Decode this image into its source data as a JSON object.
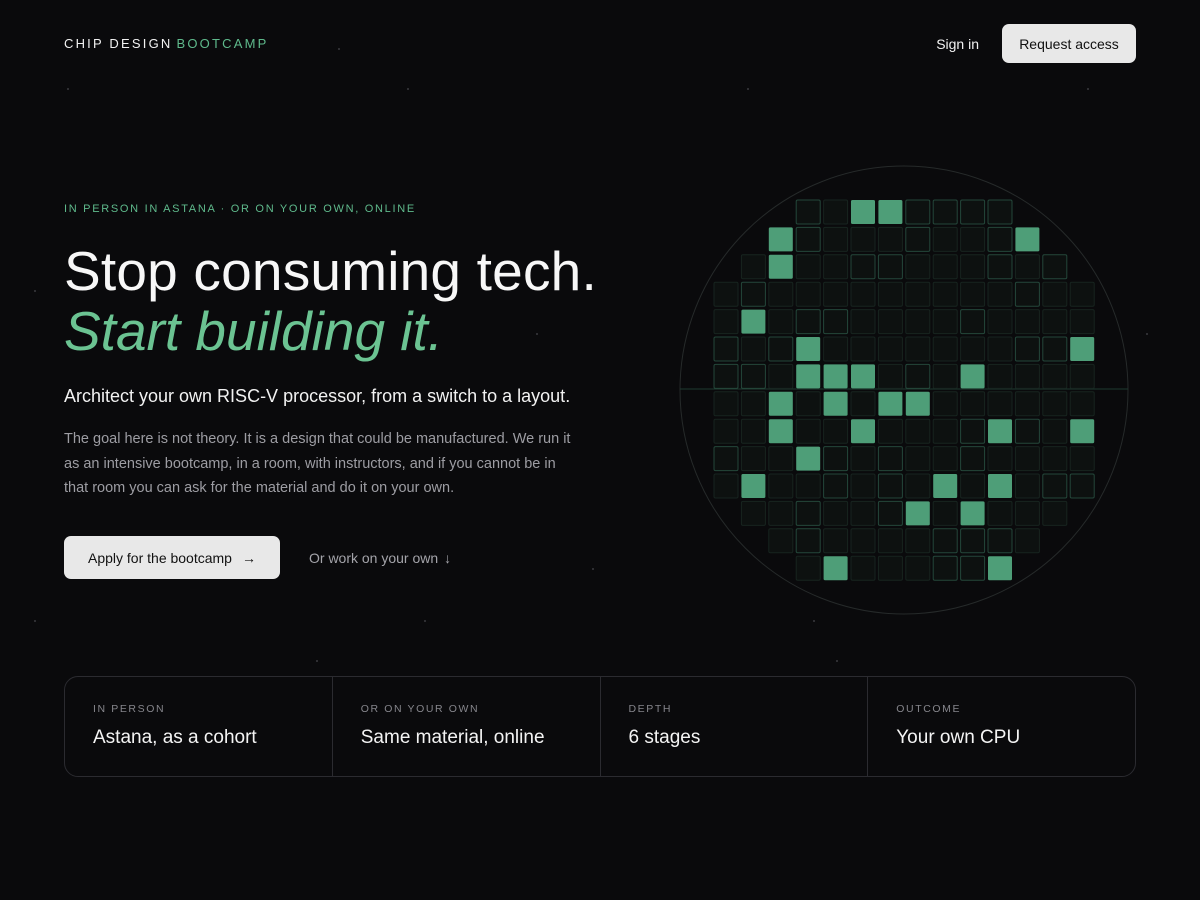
{
  "header": {
    "logo_part1": "CHIP DESIGN",
    "logo_part2": "BOOTCAMP",
    "signin_label": "Sign in",
    "request_label": "Request access"
  },
  "hero": {
    "eyebrow": "IN PERSON IN ASTANA · OR ON YOUR OWN, ONLINE",
    "title_line1": "Stop consuming tech.",
    "title_line2": "Start building it.",
    "lead": "Architect your own RISC-V processor, from a switch to a layout.",
    "body": "The goal here is not theory. It is a design that could be manufactured. We run it as an intensive bootcamp, in a room, with instructors, and if you cannot be in that room you can ask for the material and do it on your own.",
    "apply_label": "Apply for the bootcamp",
    "apply_icon": "arrow-right-icon",
    "own_label": "Or work on your own",
    "own_icon": "arrow-down-icon"
  },
  "stats": [
    {
      "label": "IN PERSON",
      "value": "Astana, as a cohort"
    },
    {
      "label": "OR ON YOUR OWN",
      "value": "Same material, online"
    },
    {
      "label": "DEPTH",
      "value": "6 stages"
    },
    {
      "label": "OUTCOME",
      "value": "Your own CPU"
    }
  ],
  "colors": {
    "background": "#0a0a0c",
    "accent": "#5fba8c",
    "die_lit": "#4e9e78",
    "button_bg": "#e8e8e8"
  }
}
